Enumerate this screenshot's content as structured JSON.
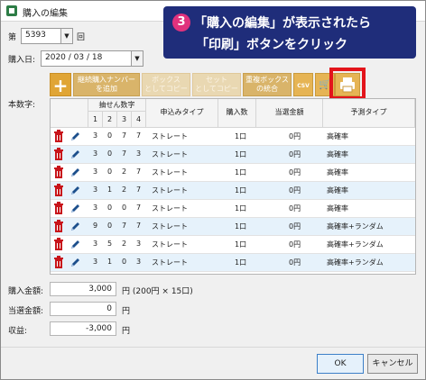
{
  "window": {
    "title": "購入の編集"
  },
  "callout": {
    "number": "3",
    "line1": "「購入の編集」が表示されたら",
    "line2": "「印刷」ボタンをクリック"
  },
  "form": {
    "round_label": "第",
    "round_value": "5393",
    "round_suffix": "回",
    "date_label": "購入日:",
    "date_value": "2020 / 03 / 18",
    "numbers_label": "本数字:"
  },
  "toolbar": {
    "add_label": "+",
    "continuous_label_1": "継続購入ナンバー",
    "continuous_label_2": "を追加",
    "box_copy_label_1": "ボックス",
    "box_copy_label_2": "としてコピー",
    "set_copy_label_1": "セット",
    "set_copy_label_2": "としてコピー",
    "dup_box_label_1": "重複ボックス",
    "dup_box_label_2": "の統合",
    "csv_label": "CSV",
    "cart_label": "🛒",
    "print_label": "印刷"
  },
  "table": {
    "group_header": "抽せん数字",
    "digit_headers": [
      "1",
      "2",
      "3",
      "4"
    ],
    "col_type": "申込みタイプ",
    "col_count": "購入数",
    "col_win": "当選金額",
    "col_predict": "予測タイプ",
    "rows": [
      {
        "d1": "3",
        "d2": "0",
        "d3": "7",
        "d4": "7",
        "type": "ストレート",
        "count": "1口",
        "win": "0円",
        "predict": "高確率"
      },
      {
        "d1": "3",
        "d2": "0",
        "d3": "7",
        "d4": "3",
        "type": "ストレート",
        "count": "1口",
        "win": "0円",
        "predict": "高確率"
      },
      {
        "d1": "3",
        "d2": "0",
        "d3": "2",
        "d4": "7",
        "type": "ストレート",
        "count": "1口",
        "win": "0円",
        "predict": "高確率"
      },
      {
        "d1": "3",
        "d2": "1",
        "d3": "2",
        "d4": "7",
        "type": "ストレート",
        "count": "1口",
        "win": "0円",
        "predict": "高確率"
      },
      {
        "d1": "3",
        "d2": "0",
        "d3": "0",
        "d4": "7",
        "type": "ストレート",
        "count": "1口",
        "win": "0円",
        "predict": "高確率"
      },
      {
        "d1": "9",
        "d2": "0",
        "d3": "7",
        "d4": "7",
        "type": "ストレート",
        "count": "1口",
        "win": "0円",
        "predict": "高確率+ランダム"
      },
      {
        "d1": "3",
        "d2": "5",
        "d3": "2",
        "d4": "3",
        "type": "ストレート",
        "count": "1口",
        "win": "0円",
        "predict": "高確率+ランダム"
      },
      {
        "d1": "3",
        "d2": "1",
        "d3": "0",
        "d4": "3",
        "type": "ストレート",
        "count": "1口",
        "win": "0円",
        "predict": "高確率+ランダム"
      }
    ]
  },
  "summary": {
    "purchase_label": "購入金額:",
    "purchase_value": "3,000",
    "purchase_unit": "円 (200円 × 15口)",
    "win_label": "当選金額:",
    "win_value": "0",
    "win_unit": "円",
    "balance_label": "収益:",
    "balance_value": "-3,000",
    "balance_unit": "円"
  },
  "buttons": {
    "ok": "OK",
    "cancel": "キャンセル"
  },
  "colors": {
    "callout": "#1f2d7a",
    "highlight": "#e3141b",
    "toolbar": "#d9b46a",
    "row_alt": "#e6f2fb"
  }
}
